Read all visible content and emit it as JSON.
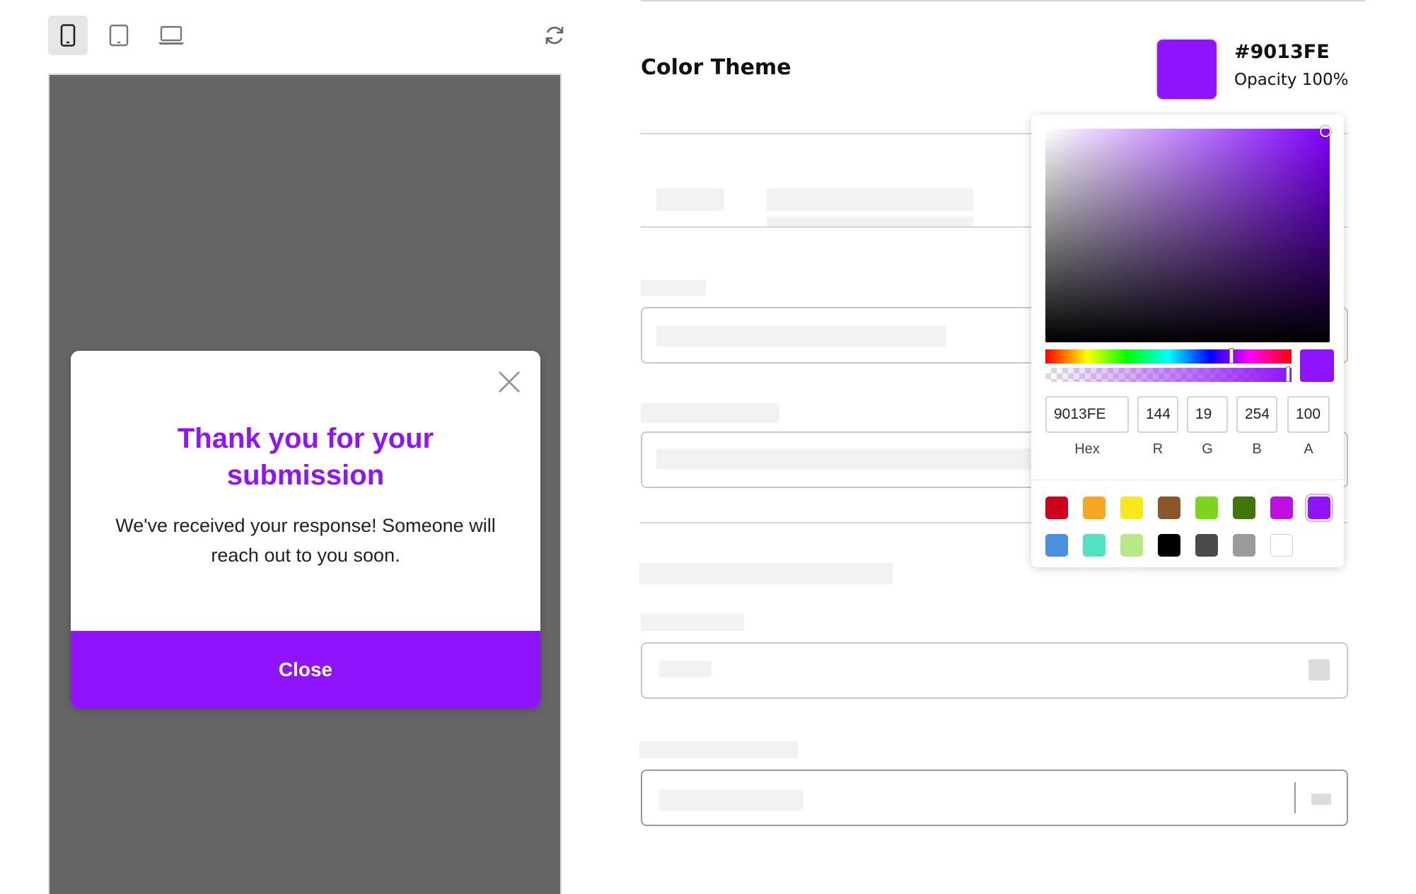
{
  "toolbar": {
    "devices": [
      {
        "name": "mobile",
        "icon": "mobile-icon",
        "active": true
      },
      {
        "name": "tablet",
        "icon": "tablet-icon",
        "active": false
      },
      {
        "name": "desktop",
        "icon": "laptop-icon",
        "active": false
      }
    ],
    "refresh_icon": "refresh-icon"
  },
  "modal": {
    "title": "Thank you for your submission",
    "body": "We've received your response! Someone will reach out to you soon.",
    "button_label": "Close",
    "accent": "#9013FE"
  },
  "settings": {
    "color_theme_label": "Color Theme",
    "current_hex": "#9013FE",
    "opacity_text": "Opacity 100%"
  },
  "picker": {
    "hex": "9013FE",
    "r": "144",
    "g": "19",
    "b": "254",
    "a": "100",
    "labels": {
      "hex": "Hex",
      "r": "R",
      "g": "G",
      "b": "B",
      "a": "A"
    },
    "hue_fraction": 0.755,
    "alpha_fraction": 1.0,
    "palette": [
      "#D0021B",
      "#F5A623",
      "#F8E71C",
      "#8B572A",
      "#7ED321",
      "#417505",
      "#BD10E0",
      "#9013FE",
      "#4A90E2",
      "#50E3C2",
      "#B8E986",
      "#000000",
      "#4A4A4A",
      "#9B9B9B",
      "#FFFFFF"
    ],
    "selected_color": "#9013FE"
  }
}
